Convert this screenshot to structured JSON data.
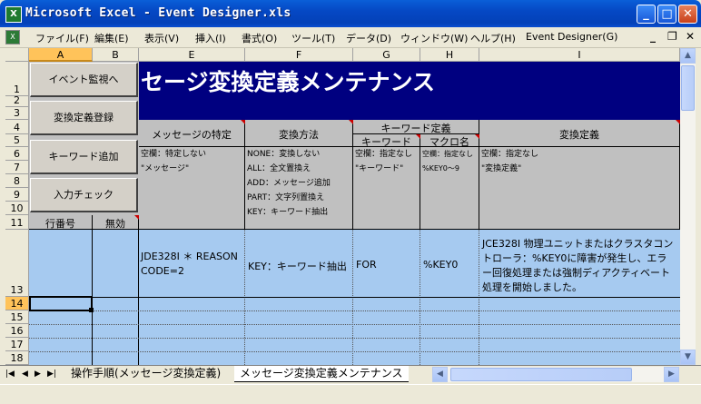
{
  "window": {
    "title": "Microsoft Excel - Event Designer.xls",
    "app_icon": "excel-icon",
    "min": "_",
    "max": "□",
    "close": "✕"
  },
  "menu": {
    "items": [
      "ファイル(F)",
      "編集(E)",
      "表示(V)",
      "挿入(I)",
      "書式(O)",
      "ツール(T)",
      "データ(D)",
      "ウィンドウ(W)",
      "ヘルプ(H)",
      "Event Designer(G)"
    ],
    "ctl_min": "_",
    "ctl_restore": "❐",
    "ctl_close": "✕"
  },
  "columns": [
    "A",
    "B",
    "E",
    "F",
    "G",
    "H",
    "I"
  ],
  "rows": [
    "1",
    "2",
    "3",
    "4",
    "5",
    "6",
    "7",
    "8",
    "9",
    "10",
    "11",
    "13",
    "14",
    "15",
    "16",
    "17",
    "18"
  ],
  "banner": "セージ変換定義メンテナンス",
  "macro_buttons": [
    "イベント監視へ",
    "変換定義登録",
    "キーワード追加",
    "入力チェック"
  ],
  "headers": {
    "message_spec": "メッセージの特定",
    "conversion_method": "変換方法",
    "keyword_def": "キーワード定義",
    "keyword": "キーワード",
    "macro_name": "マクロ名",
    "conversion_def": "変換定義",
    "line_no": "行番号",
    "disabled": "無効"
  },
  "notes": {
    "message_spec": [
      "空欄：特定しない",
      "\"メッセージ\""
    ],
    "conversion_method": [
      "NONE：変換しない",
      "ALL：全文置換え",
      "ADD：メッセージ追加",
      "PART：文字列置換え",
      "KEY：キーワード抽出"
    ],
    "keyword": [
      "空欄：指定なし",
      "\"キーワード\""
    ],
    "macro_name": [
      "空欄：指定なし",
      "%KEY0～9"
    ],
    "conversion_def": [
      "空欄：指定なし",
      "\"変換定義\""
    ]
  },
  "data_row": {
    "message": "JDE328I ＊ REASON CODE=2",
    "method": "KEY：キーワード抽出",
    "keyword": "FOR",
    "macro": "%KEY0",
    "definition": "JCE328I 物理ユニットまたはクラスタコントローラ：%KEY0に障害が発生し、エラー回復処理または強制ディアクティベート処理を開始しました。"
  },
  "sheet_tabs": [
    "操作手順(メッセージ変換定義)",
    "メッセージ変換定義メンテナンス"
  ],
  "colors": {
    "banner_bg": "#000080",
    "header_gray": "#c0c0c0",
    "data_blue": "#a6caf0",
    "selection": "#ffc35a"
  }
}
